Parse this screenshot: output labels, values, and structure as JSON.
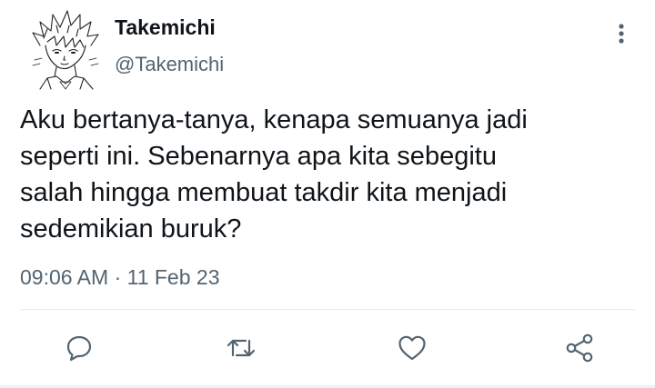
{
  "user": {
    "display_name": "Takemichi",
    "handle": "@Takemichi",
    "avatar_icon": "anime-sketch-avatar"
  },
  "tweet": {
    "text": "Aku bertanya-tanya, kenapa semuanya jadi\nseperti ini. Sebenarnya apa kita sebegitu\nsalah hingga membuat takdir kita menjadi\nsedemikian buruk?",
    "timestamp": "09:06 AM · 11 Feb 23"
  },
  "actions": [
    {
      "name": "reply",
      "icon": "speech-bubble-icon"
    },
    {
      "name": "retweet",
      "icon": "retweet-icon"
    },
    {
      "name": "like",
      "icon": "heart-icon"
    },
    {
      "name": "share",
      "icon": "share-icon"
    }
  ],
  "colors": {
    "text_primary": "#0f1419",
    "text_secondary": "#536471",
    "icon": "#536471",
    "divider": "#e6ecf0"
  }
}
